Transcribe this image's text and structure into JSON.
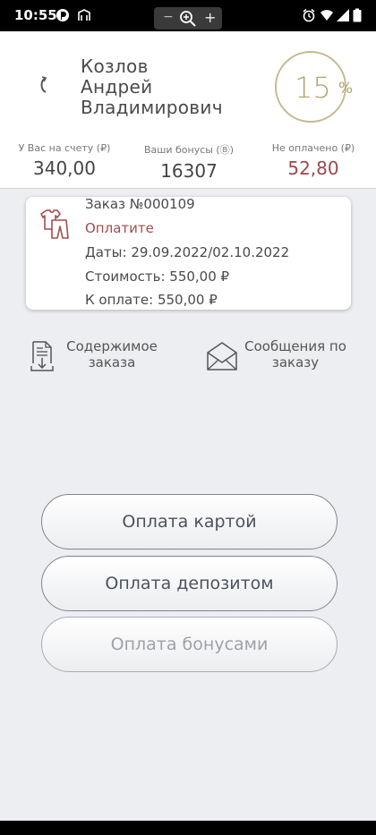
{
  "status_bar": {
    "time": "10:55"
  },
  "header": {
    "name_lines": [
      "Козлов",
      "Андрей",
      "Владимирович"
    ],
    "discount_value": "15",
    "discount_unit": "%",
    "stats": [
      {
        "label": "У Вас на счету (₽)",
        "value": "340,00"
      },
      {
        "label": "Ваши бонусы (Ⓑ)",
        "value": "16307"
      },
      {
        "label": "Не оплачено (₽)",
        "value": "52,80"
      }
    ]
  },
  "order": {
    "number": "Заказ №000109",
    "status": "Оплатите",
    "dates": "Даты: 29.09.2022/02.10.2022",
    "cost": "Стоимость: 550,00 ₽",
    "to_pay": "К оплате: 550,00 ₽"
  },
  "actions": {
    "contents_line1": "Содержимое",
    "contents_line2": "заказа",
    "messages_line1": "Сообщения по",
    "messages_line2": "заказу"
  },
  "payments": {
    "card": "Оплата картой",
    "deposit": "Оплата депозитом",
    "bonus": "Оплата бонусами"
  },
  "colors": {
    "accent_gold": "#b3a272",
    "debt_red": "#9a4a48",
    "status_red": "#a04e4c",
    "background": "#eceef1"
  }
}
